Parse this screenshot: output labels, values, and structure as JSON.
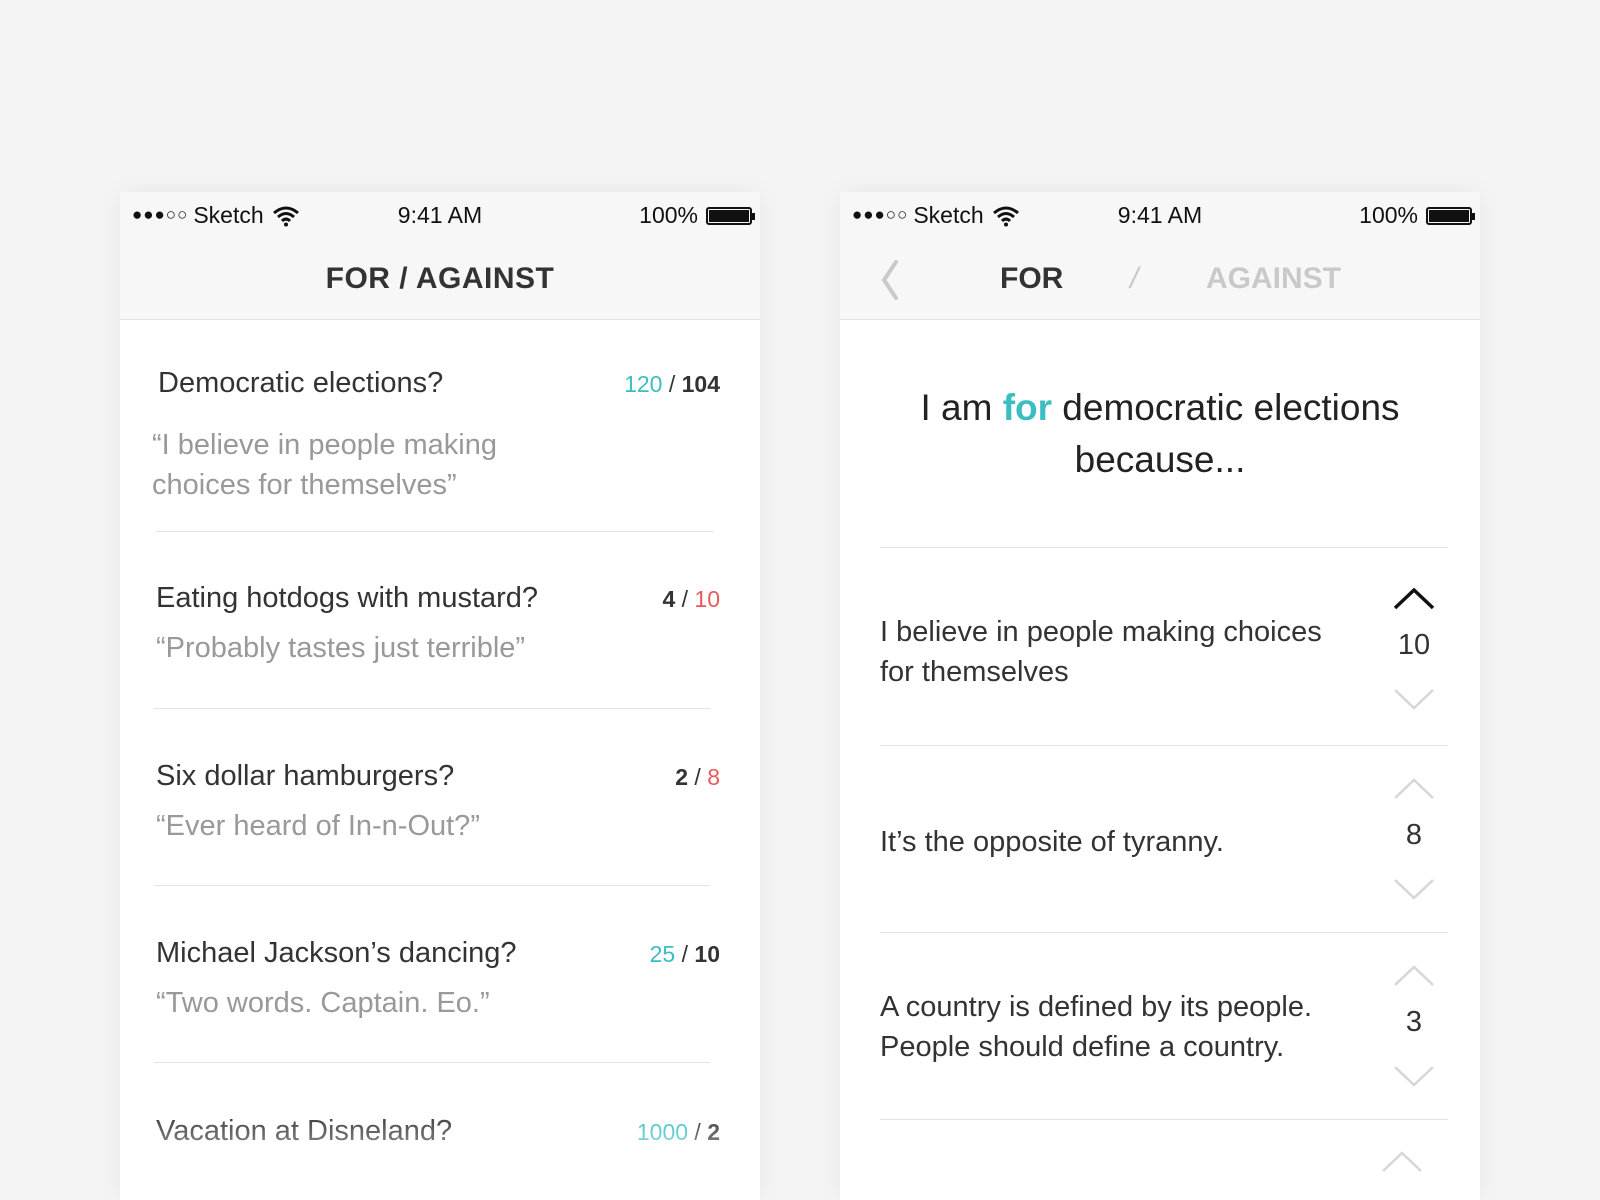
{
  "status_bar": {
    "carrier": "Sketch",
    "time": "9:41 AM",
    "battery": "100%"
  },
  "left_screen": {
    "title": "FOR / AGAINST",
    "debates": [
      {
        "title": "Democratic elections?",
        "for": "120",
        "against": "104",
        "quote": "“I believe in people making choices for themselves”",
        "for_color": "#3bbec2",
        "against_color": "#333333"
      },
      {
        "title": "Eating hotdogs with mustard?",
        "for": "4",
        "against": "10",
        "quote": "“Probably tastes just terrible”",
        "for_color": "#333333",
        "against_color": "#e8595a"
      },
      {
        "title": "Six dollar hamburgers?",
        "for": "2",
        "against": "8",
        "quote": "“Ever heard of In-n-Out?”",
        "for_color": "#333333",
        "against_color": "#e8595a"
      },
      {
        "title": "Michael Jackson’s dancing?",
        "for": "25",
        "against": "10",
        "quote": "“Two words. Captain. Eo.”",
        "for_color": "#3bbec2",
        "against_color": "#333333"
      },
      {
        "title": "Vacation at Disneland?",
        "for": "1000",
        "against": "2",
        "quote": "",
        "for_color": "#3bbec2",
        "against_color": "#333333"
      }
    ]
  },
  "right_screen": {
    "nav": {
      "for_label": "FOR",
      "slash": "/",
      "against_label": "AGAINST"
    },
    "headline": {
      "prefix": "I am ",
      "stance": "for",
      "suffix": " democratic elections because..."
    },
    "reasons": [
      {
        "text": "I believe in people making choices for themselves",
        "votes": "10",
        "upvoted": true
      },
      {
        "text": "It’s the opposite of tyranny.",
        "votes": "8",
        "upvoted": false
      },
      {
        "text": "A country is defined by its people. People should define a country.",
        "votes": "3",
        "upvoted": false
      }
    ]
  },
  "colors": {
    "teal": "#3bbec2",
    "red": "#e8595a",
    "text": "#333333",
    "muted": "#999999",
    "inactive": "#c9c9c9"
  },
  "icons": [
    "wifi-icon",
    "battery-icon",
    "back-chevron-icon",
    "upvote-chevron-icon",
    "downvote-chevron-icon"
  ]
}
